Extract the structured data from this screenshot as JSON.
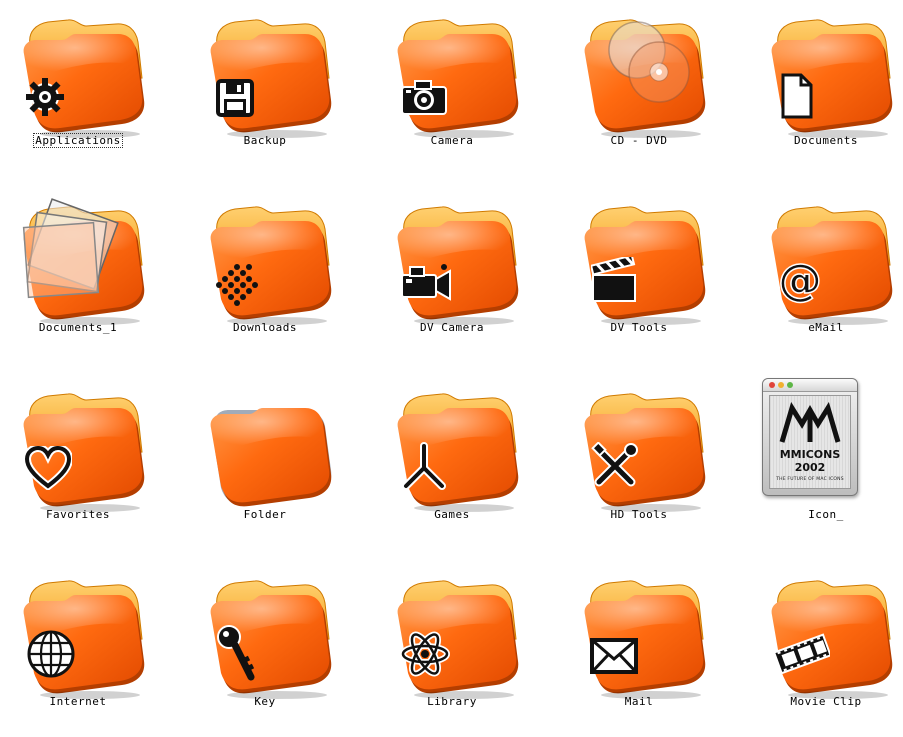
{
  "icons": [
    {
      "label": "Applications",
      "icon": "gear-icon",
      "selected": true
    },
    {
      "label": "Backup",
      "icon": "floppy-disk-icon"
    },
    {
      "label": "Camera",
      "icon": "camera-icon"
    },
    {
      "label": "CD - DVD",
      "icon": "disc-icon"
    },
    {
      "label": "Documents",
      "icon": "document-icon"
    },
    {
      "label": "Documents_1",
      "icon": "stacked-pages-icon"
    },
    {
      "label": "Downloads",
      "icon": "dots-grid-icon"
    },
    {
      "label": "DV Camera",
      "icon": "video-camera-icon"
    },
    {
      "label": "DV Tools",
      "icon": "clapperboard-icon"
    },
    {
      "label": "eMail",
      "icon": "at-sign-icon"
    },
    {
      "label": "Favorites",
      "icon": "heart-icon"
    },
    {
      "label": "Folder",
      "icon": "plain-folder-icon"
    },
    {
      "label": "Games",
      "icon": "tripod-icon"
    },
    {
      "label": "HD Tools",
      "icon": "tools-icon"
    },
    {
      "label": "Icon_",
      "icon": "mmicons-logo-icon"
    },
    {
      "label": "Internet",
      "icon": "globe-icon"
    },
    {
      "label": "Key",
      "icon": "key-icon"
    },
    {
      "label": "Library",
      "icon": "atom-icon"
    },
    {
      "label": "Mail",
      "icon": "envelope-icon"
    },
    {
      "label": "Movie Clip",
      "icon": "film-strip-icon"
    }
  ],
  "icon_box": {
    "brand": "MMICONS 2002",
    "tagline": "THE FUTURE OF MAC ICONS"
  },
  "colors": {
    "folder_front": "#ff6a10",
    "folder_back": "#f6a21a",
    "folder_shadow": "#b84000"
  }
}
